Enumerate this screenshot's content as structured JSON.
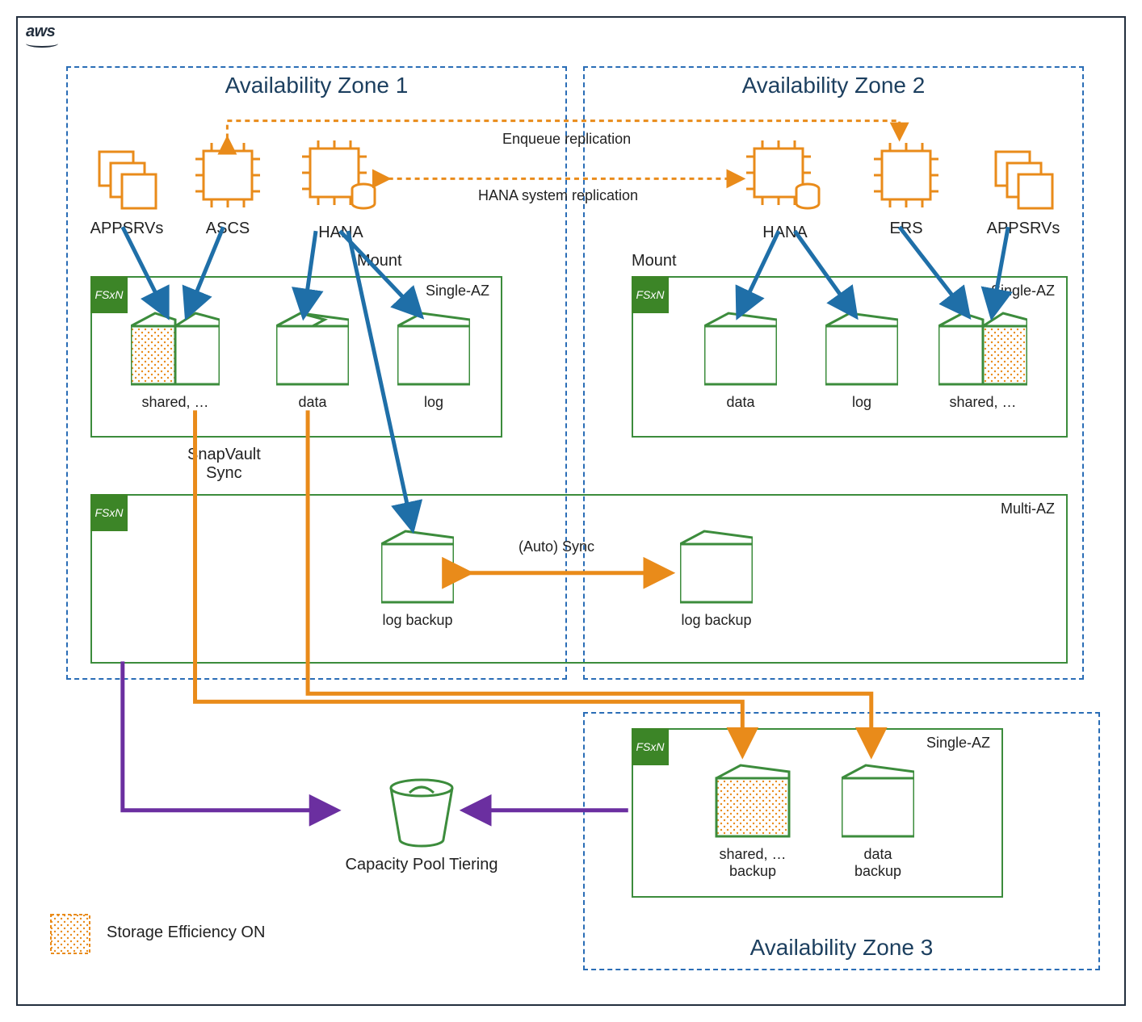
{
  "brand": {
    "aws": "aws",
    "fsx_badge": "FSxN"
  },
  "az": {
    "one_title": "Availability Zone 1",
    "two_title": "Availability Zone 2",
    "three_title": "Availability Zone 3"
  },
  "compute": {
    "az1": {
      "appsrvs": "APPSRVs",
      "ascs": "ASCS",
      "hana": "HANA"
    },
    "az2": {
      "hana": "HANA",
      "ers": "ERS",
      "appsrvs": "APPSRVs"
    }
  },
  "replication": {
    "enqueue": "Enqueue replication",
    "hana_system": "HANA system replication"
  },
  "mount_label_left": "Mount",
  "mount_label_right": "Mount",
  "fsx": {
    "az1_label": "Single-AZ",
    "az2_label": "Single-AZ",
    "multi_label": "Multi-AZ",
    "az3_label": "Single-AZ"
  },
  "volumes": {
    "az1": {
      "shared": "shared, …",
      "data": "data",
      "log": "log"
    },
    "az2": {
      "data": "data",
      "log": "log",
      "shared": "shared, …"
    },
    "multi": {
      "log_backup_left": "log backup",
      "auto_sync": "(Auto) Sync",
      "log_backup_right": "log backup"
    },
    "az3": {
      "shared_backup": "shared, …\nbackup",
      "data_backup": "data\nbackup"
    }
  },
  "snapvault_label": "SnapVault\nSync",
  "capacity_pool": "Capacity Pool Tiering",
  "legend": {
    "storage_efficiency": "Storage Efficiency ON"
  },
  "colors": {
    "green": "#3c8c3c",
    "green_dark": "#2e6b2e",
    "orange": "#e98b1a",
    "orange_light": "#f2a73c",
    "blue_arrow": "#1f6fa8",
    "purple": "#6b2fa0",
    "navy": "#1c3f5f",
    "dash_blue": "#2a6db6"
  }
}
